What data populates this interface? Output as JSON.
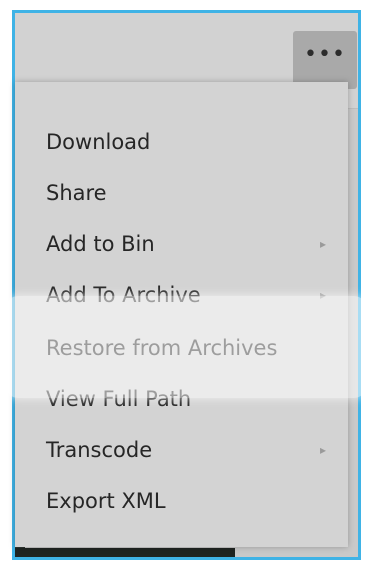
{
  "menu": {
    "more_label": "•••",
    "items": [
      {
        "label": "Download",
        "has_submenu": false
      },
      {
        "label": "Share",
        "has_submenu": false
      },
      {
        "label": "Add to Bin",
        "has_submenu": true
      },
      {
        "label": "Add To Archive",
        "has_submenu": true
      },
      {
        "label": "Restore from Archives",
        "has_submenu": false
      },
      {
        "label": "View Full Path",
        "has_submenu": false
      },
      {
        "label": "Transcode",
        "has_submenu": true
      },
      {
        "label": "Export XML",
        "has_submenu": false
      }
    ],
    "highlighted_item": "Restore from Archives",
    "submenu_glyph": "▸"
  },
  "colors": {
    "frame_border": "#3fb3e6",
    "menu_bg": "#d3d3d3",
    "button_bg": "#a9a9a9"
  }
}
